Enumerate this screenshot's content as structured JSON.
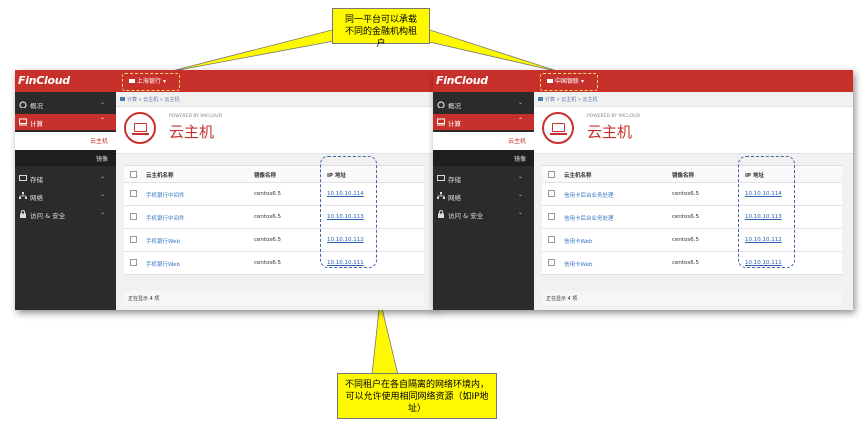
{
  "callouts": {
    "top": "同一平台可以承载不同的金融机构租户",
    "bottom": "不同租户在各自隔离的网络环境内，可以允许使用相同网络资源（如IP地址）"
  },
  "colors": {
    "brand": "#c8302b",
    "sidebar": "#2b2b2b",
    "link": "#3a78c2",
    "callout": "#fff900"
  },
  "panels": [
    {
      "logo": "FinCloud",
      "tenant": "上海银行",
      "sidebar": [
        {
          "label": "概况",
          "icon": "dashboard-icon"
        },
        {
          "label": "计算",
          "icon": "monitor-icon"
        },
        {
          "label": "存储",
          "icon": "storage-icon"
        },
        {
          "label": "网络",
          "icon": "network-icon"
        },
        {
          "label": "访问 & 安全",
          "icon": "lock-icon"
        }
      ],
      "sub_items": [
        "云主机",
        "镜像"
      ],
      "breadcrumb": "计算 » 云主机 » 云主机",
      "powered_by": "POWERED BY 99CLOUD",
      "page_title": "云主机",
      "columns": [
        "云主机名称",
        "镜像名称",
        "IP 地址"
      ],
      "rows": [
        {
          "name": "手机银行中间件",
          "image": "centos6.5",
          "ip": "10.10.10.114"
        },
        {
          "name": "手机银行中间件",
          "image": "centos6.5",
          "ip": "10.10.10.113"
        },
        {
          "name": "手机银行Web",
          "image": "centos6.5",
          "ip": "10.10.10.112"
        },
        {
          "name": "手机银行Web",
          "image": "centos6.5",
          "ip": "10.10.10.111"
        }
      ],
      "footer": "正在显示 4 项"
    },
    {
      "logo": "FinCloud",
      "tenant": "中国银联",
      "sidebar": [
        {
          "label": "概况",
          "icon": "dashboard-icon"
        },
        {
          "label": "计算",
          "icon": "monitor-icon"
        },
        {
          "label": "存储",
          "icon": "storage-icon"
        },
        {
          "label": "网络",
          "icon": "network-icon"
        },
        {
          "label": "访问 & 安全",
          "icon": "lock-icon"
        }
      ],
      "sub_items": [
        "云主机",
        "镜像"
      ],
      "breadcrumb": "计算 » 云主机 » 云主机",
      "powered_by": "POWERED BY 99CLOUD",
      "page_title": "云主机",
      "columns": [
        "云主机名称",
        "镜像名称",
        "IP 地址"
      ],
      "rows": [
        {
          "name": "信用卡后台业务处理",
          "image": "centos6.5",
          "ip": "10.10.10.114"
        },
        {
          "name": "信用卡后台业务处理",
          "image": "centos6.5",
          "ip": "10.10.10.113"
        },
        {
          "name": "信用卡Web",
          "image": "centos6.5",
          "ip": "10.10.10.112"
        },
        {
          "name": "信用卡Web",
          "image": "centos6.5",
          "ip": "10.10.10.111"
        }
      ],
      "footer": "正在显示 4 项"
    }
  ]
}
